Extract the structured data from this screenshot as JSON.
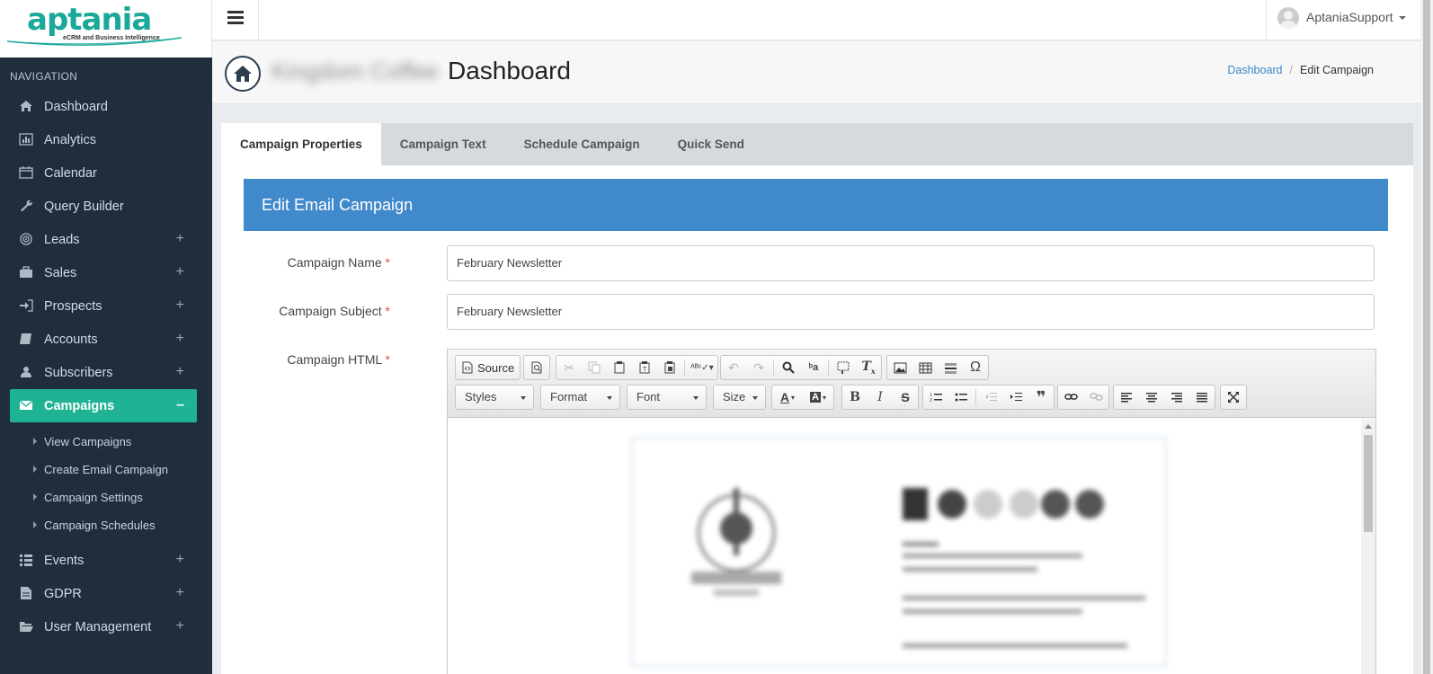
{
  "brand": {
    "name": "aptania",
    "tagline": "eCRM and Business Intelligence",
    "color": "#1aa89a"
  },
  "sidebar": {
    "header": "NAVIGATION",
    "items": [
      {
        "label": "Dashboard",
        "icon": "home-icon"
      },
      {
        "label": "Analytics",
        "icon": "bar-chart-icon"
      },
      {
        "label": "Calendar",
        "icon": "calendar-icon"
      },
      {
        "label": "Query Builder",
        "icon": "wrench-icon"
      },
      {
        "label": "Leads",
        "icon": "target-icon",
        "expander": "+"
      },
      {
        "label": "Sales",
        "icon": "briefcase-icon",
        "expander": "+"
      },
      {
        "label": "Prospects",
        "icon": "sign-in-icon",
        "expander": "+"
      },
      {
        "label": "Accounts",
        "icon": "book-icon",
        "expander": "+"
      },
      {
        "label": "Subscribers",
        "icon": "user-icon",
        "expander": "+"
      },
      {
        "label": "Campaigns",
        "icon": "envelope-icon",
        "expander": "–",
        "active": true
      },
      {
        "label": "Events",
        "icon": "list-icon",
        "expander": "+"
      },
      {
        "label": "GDPR",
        "icon": "document-icon",
        "expander": "+"
      },
      {
        "label": "User Management",
        "icon": "folder-icon",
        "expander": "+"
      }
    ],
    "subitems": [
      "View Campaigns",
      "Create Email Campaign",
      "Campaign Settings",
      "Campaign Schedules"
    ],
    "active_color": "#1fb394"
  },
  "topbar": {
    "user": "AptaniaSupport"
  },
  "header": {
    "company_blurred": "Kingdom Coffee",
    "title": "Dashboard",
    "breadcrumb": {
      "home": "Dashboard",
      "sep": "/",
      "current": "Edit Campaign"
    }
  },
  "tabs": [
    "Campaign Properties",
    "Campaign Text",
    "Schedule Campaign",
    "Quick Send"
  ],
  "panel": {
    "title": "Edit Email Campaign",
    "color": "#4089cb"
  },
  "form": {
    "name_label": "Campaign Name",
    "name_value": "February Newsletter",
    "subject_label": "Campaign Subject",
    "subject_value": "February Newsletter",
    "html_label": "Campaign HTML",
    "required_mark": "*"
  },
  "editor": {
    "source_label": "Source",
    "styles": "Styles",
    "format": "Format",
    "font": "Font",
    "size": "Size"
  }
}
